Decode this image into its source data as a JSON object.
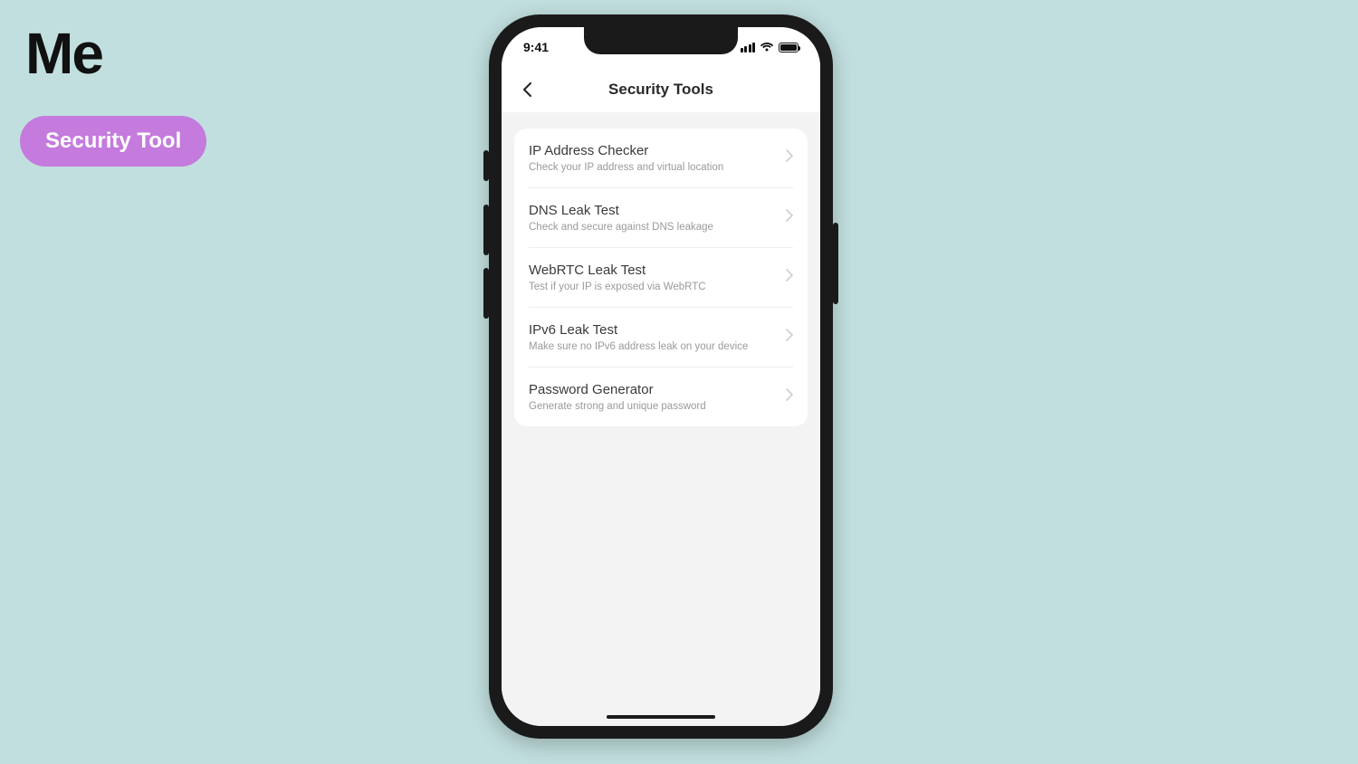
{
  "annotation": {
    "me_label": "Me",
    "pill_label": "Security Tool"
  },
  "status": {
    "time": "9:41"
  },
  "nav": {
    "title": "Security Tools"
  },
  "tools": [
    {
      "title": "IP Address Checker",
      "sub": "Check your IP address and virtual location"
    },
    {
      "title": "DNS Leak Test",
      "sub": "Check and secure against DNS leakage"
    },
    {
      "title": "WebRTC Leak Test",
      "sub": "Test if your IP is exposed via WebRTC"
    },
    {
      "title": "IPv6 Leak Test",
      "sub": "Make sure no IPv6 address leak on your device"
    },
    {
      "title": "Password Generator",
      "sub": "Generate strong and unique password"
    }
  ]
}
